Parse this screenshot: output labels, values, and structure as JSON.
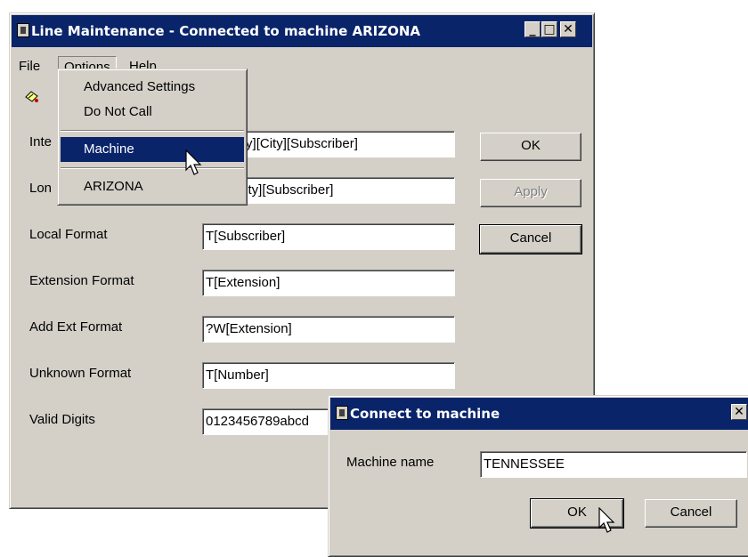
{
  "main_window": {
    "title": "Line Maintenance - Connected to machine ARIZONA",
    "menu": {
      "file": "File",
      "options": "Options",
      "help": "Help"
    },
    "options_menu": {
      "items": [
        "Advanced Settings",
        "Do Not Call",
        "Machine",
        "ARIZONA"
      ],
      "selected": "Machine"
    },
    "fields": [
      {
        "label": "Inte",
        "value": "Country][City][Subscriber]"
      },
      {
        "label": "Lon",
        "value": "ntry][City][Subscriber]"
      },
      {
        "label": "Local Format",
        "value": "T[Subscriber]"
      },
      {
        "label": "Extension Format",
        "value": "T[Extension]"
      },
      {
        "label": "Add Ext Format",
        "value": "?W[Extension]"
      },
      {
        "label": "Unknown Format",
        "value": "T[Number]"
      },
      {
        "label": "Valid Digits",
        "value": "0123456789abcd"
      }
    ],
    "buttons": {
      "ok": "OK",
      "apply": "Apply",
      "cancel": "Cancel"
    }
  },
  "connect_dialog": {
    "title": "Connect to machine",
    "machine_label": "Machine name",
    "machine_value": "TENNESSEE",
    "buttons": {
      "ok": "OK",
      "cancel": "Cancel"
    }
  },
  "colors": {
    "titlebar": "#0a246a",
    "face": "#d4d0c8",
    "selection": "#0a246a"
  },
  "icons": [
    "app-icon",
    "minimize-icon",
    "maximize-icon",
    "close-icon",
    "toolbar-icon",
    "mouse-pointer-icon"
  ]
}
